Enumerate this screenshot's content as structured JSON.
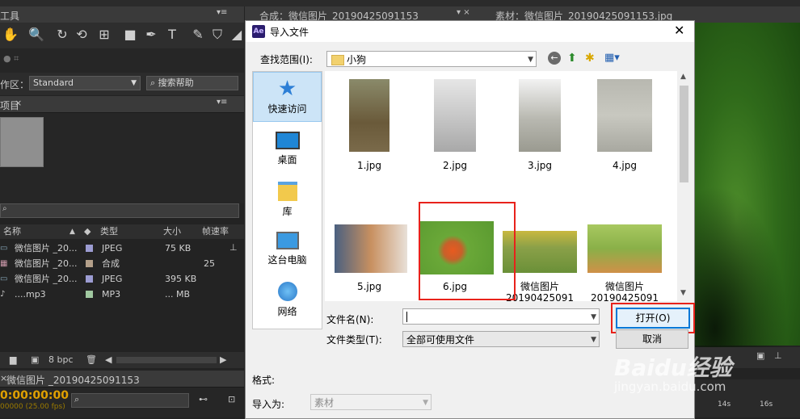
{
  "background": {
    "tabs": {
      "composition": "合成：微信图片_20190425091153",
      "footage": "素材：微信图片_20190425091153.jpg"
    },
    "tools_label": "工具",
    "workspace": {
      "label": "作区：",
      "value": "Standard",
      "search": "搜索帮助"
    },
    "project_tab": "项目",
    "project_columns": {
      "name": "名称",
      "type": "类型",
      "size": "大小",
      "rate": "帧速率"
    },
    "project_items": [
      {
        "name": "微信图片 _20...",
        "type": "JPEG",
        "size": "75 KB",
        "rate": "",
        "color": "#9c9cd2"
      },
      {
        "name": "微信图片 _20...",
        "type": "合成",
        "size": "",
        "rate": "25",
        "color": "#b4a08a"
      },
      {
        "name": "微信图片 _20...",
        "type": "JPEG",
        "size": "395 KB",
        "rate": "",
        "color": "#9c9cd2"
      },
      {
        "name": "....mp3",
        "type": "MP3",
        "size": "... MB",
        "rate": "",
        "color": "#a0c8a0"
      }
    ],
    "bpc": "8 bpc",
    "timeline_tab": "微信图片 _20190425091153",
    "timecode": "0:00:00:00",
    "fps": "00000 (25.00 fps)",
    "ruler": [
      "14s",
      "16s"
    ]
  },
  "dialog": {
    "title": "导入文件",
    "lookin_label": "查找范围(I):",
    "lookin_value": "小狗",
    "places": [
      "快速访问",
      "桌面",
      "库",
      "这台电脑",
      "网络"
    ],
    "files": [
      {
        "name": "1.jpg"
      },
      {
        "name": "2.jpg"
      },
      {
        "name": "3.jpg"
      },
      {
        "name": "4.jpg"
      },
      {
        "name": "5.jpg"
      },
      {
        "name": "6.jpg"
      },
      {
        "name": "微信图片\n20190425091"
      },
      {
        "name": "微信图片\n20190425091"
      }
    ],
    "filename_label": "文件名(N):",
    "filename_value": "",
    "filetype_label": "文件类型(T):",
    "filetype_value": "全部可使用文件",
    "open_button": "打开(O)",
    "cancel_button": "取消",
    "format_label": "格式:",
    "import_as_label": "导入为:",
    "import_as_value": "素材"
  },
  "watermark": {
    "brand": "Baidu经验",
    "url": "jingyan.baidu.com"
  },
  "colors": {
    "highlight_red": "#e8221b",
    "ae_bg": "#232323"
  }
}
